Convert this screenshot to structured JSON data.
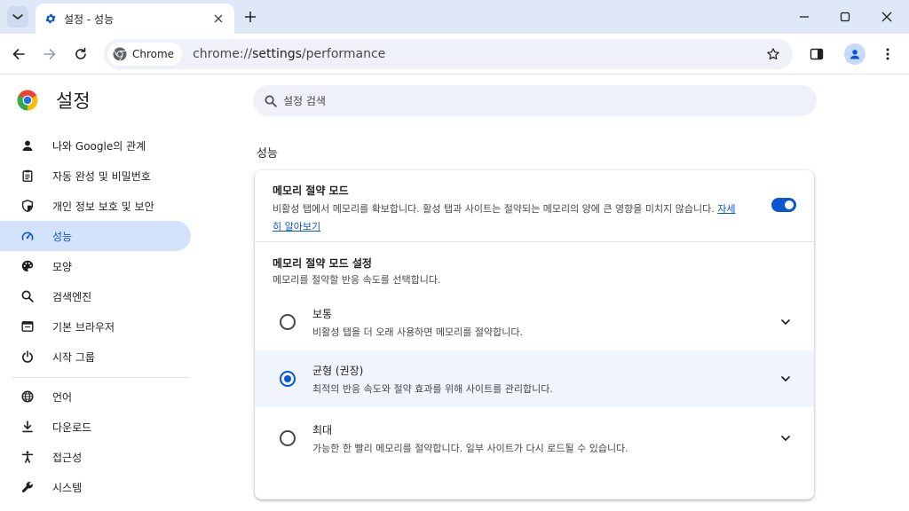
{
  "tab": {
    "title": "설정 - 성능"
  },
  "toolbar": {
    "chip_label": "Chrome",
    "url_scheme": "chrome://",
    "url_host": "settings",
    "url_path": "/performance"
  },
  "sidebar": {
    "title": "설정",
    "items": [
      {
        "label": "나와 Google의 관계",
        "icon": "person-icon"
      },
      {
        "label": "자동 완성 및 비밀번호",
        "icon": "clipboard-icon"
      },
      {
        "label": "개인 정보 보호 및 보안",
        "icon": "shield-icon"
      },
      {
        "label": "성능",
        "icon": "speedometer-icon",
        "active": true
      },
      {
        "label": "모양",
        "icon": "palette-icon"
      },
      {
        "label": "검색엔진",
        "icon": "search-icon"
      },
      {
        "label": "기본 브라우저",
        "icon": "browser-icon"
      },
      {
        "label": "시작 그룹",
        "icon": "power-icon"
      },
      {
        "label": "언어",
        "icon": "globe-icon"
      },
      {
        "label": "다운로드",
        "icon": "download-icon"
      },
      {
        "label": "접근성",
        "icon": "accessibility-icon"
      },
      {
        "label": "시스템",
        "icon": "wrench-icon"
      }
    ]
  },
  "search": {
    "placeholder": "설정 검색"
  },
  "section": {
    "title": "성능"
  },
  "memory_saver": {
    "title": "메모리 절약 모드",
    "description": "비활성 탭에서 메모리를 확보합니다. 활성 탭과 사이트는 절약되는 메모리의 양에 큰 영향을 미치지 않습니다.",
    "link": "자세히 알아보기",
    "enabled": true,
    "accent_color": "#0b57d0"
  },
  "settings": {
    "title": "메모리 절약 모드 설정",
    "description": "메모리를 절약할 반응 속도를 선택합니다.",
    "options": [
      {
        "title": "보통",
        "description": "비활성 탭을 더 오래 사용하면 메모리를 절약합니다.",
        "selected": false
      },
      {
        "title": "균형 (권장)",
        "description": "최적의 반응 속도와 절약 효과를 위해 사이트를 관리합니다.",
        "selected": true
      },
      {
        "title": "최대",
        "description": "가능한 한 빨리 메모리를 절약합니다. 일부 사이트가 다시 로드될 수 있습니다.",
        "selected": false
      }
    ]
  }
}
